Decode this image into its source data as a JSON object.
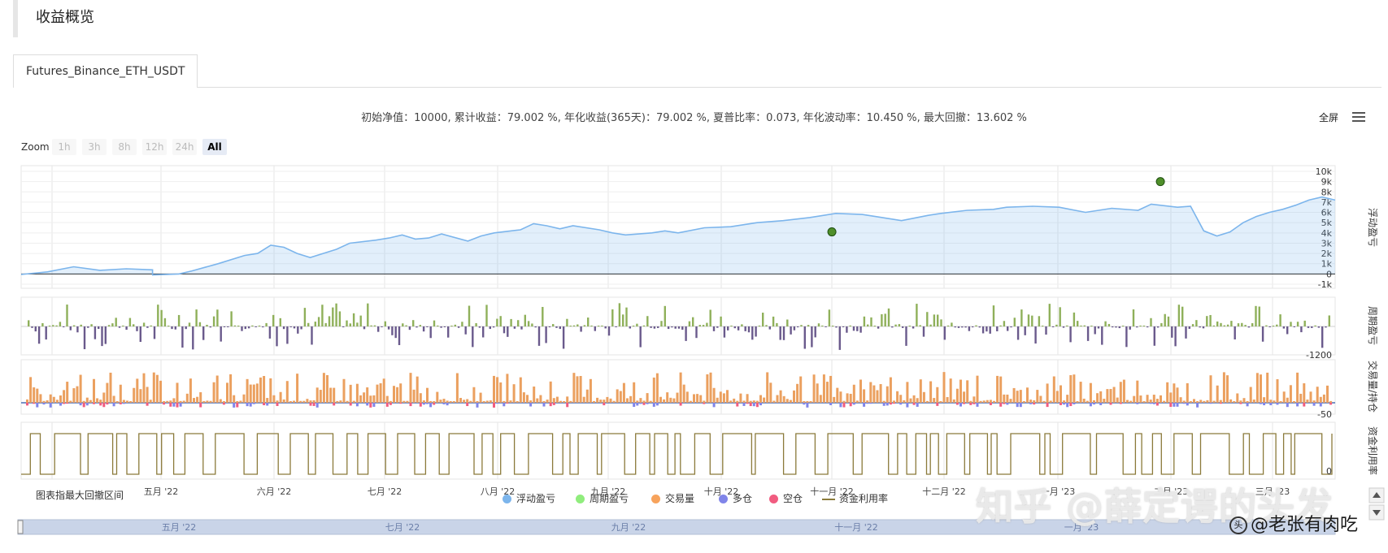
{
  "section": {
    "title": "收益概览"
  },
  "tabs": [
    {
      "label": "Futures_Binance_ETH_USDT",
      "active": true
    }
  ],
  "summary": "初始净值：10000, 累计收益：79.002 %, 年化收益(365天)：79.002 %, 夏普比率：0.073, 年化波动率：10.450 %, 最大回撤：13.602 %",
  "toolbar": {
    "fullscreen": "全屏",
    "menu_icon": "menu-icon"
  },
  "zoom": {
    "label": "Zoom",
    "buttons": [
      "1h",
      "3h",
      "8h",
      "12h",
      "24h",
      "All"
    ],
    "active": "All"
  },
  "legend": {
    "drawdown_label": "图表指最大回撤区间",
    "items": [
      {
        "label": "浮动盈亏",
        "color": "#7cb5ec",
        "shape": "dot"
      },
      {
        "label": "周期盈亏",
        "color": "#90ed7d",
        "shape": "dot"
      },
      {
        "label": "交易量",
        "color": "#f7a35c",
        "shape": "dot"
      },
      {
        "label": "多仓",
        "color": "#8085e9",
        "shape": "dot"
      },
      {
        "label": "空仓",
        "color": "#f15c80",
        "shape": "dot"
      },
      {
        "label": "资金利用率",
        "color": "#8b7a3a",
        "shape": "line"
      }
    ]
  },
  "watermark": {
    "main": "知乎 @薛定谔的头发",
    "sub": "@老张有肉吃",
    "sub_icon": "头"
  },
  "chart_data": {
    "type": "line",
    "x_axis_labels": [
      "五月 '22",
      "六月 '22",
      "七月 '22",
      "八月 '22",
      "九月 '22",
      "十月 '22",
      "十一月 '22",
      "十二月 '22",
      "一月 '23",
      "二月 '23",
      "三月 '23"
    ],
    "navigator_labels": [
      "五月 '22",
      "七月 '22",
      "九月 '22",
      "十一月 '22",
      "一月 '23"
    ],
    "panes": [
      {
        "name": "浮动盈亏",
        "type": "area",
        "color": "#7cb5ec",
        "ytick_labels": [
          "10k",
          "9k",
          "8k",
          "7k",
          "6k",
          "5k",
          "4k",
          "3k",
          "2k",
          "1k",
          "0",
          "-1k"
        ],
        "ylim": [
          -1000,
          10000
        ],
        "x_range": [
          0,
          1
        ],
        "points": [
          [
            0,
            -50
          ],
          [
            0.02,
            200
          ],
          [
            0.04,
            700
          ],
          [
            0.06,
            350
          ],
          [
            0.08,
            500
          ],
          [
            0.1,
            400
          ],
          [
            0.1,
            300
          ],
          [
            0.1,
            -100
          ],
          [
            0.12,
            0
          ],
          [
            0.13,
            300
          ],
          [
            0.15,
            1000
          ],
          [
            0.17,
            1800
          ],
          [
            0.18,
            2000
          ],
          [
            0.19,
            2800
          ],
          [
            0.2,
            2600
          ],
          [
            0.21,
            2000
          ],
          [
            0.22,
            1600
          ],
          [
            0.24,
            2400
          ],
          [
            0.25,
            3000
          ],
          [
            0.27,
            3300
          ],
          [
            0.28,
            3500
          ],
          [
            0.29,
            3800
          ],
          [
            0.3,
            3400
          ],
          [
            0.31,
            3500
          ],
          [
            0.32,
            3900
          ],
          [
            0.34,
            3200
          ],
          [
            0.35,
            3700
          ],
          [
            0.36,
            4000
          ],
          [
            0.38,
            4300
          ],
          [
            0.39,
            4900
          ],
          [
            0.4,
            4700
          ],
          [
            0.41,
            4400
          ],
          [
            0.42,
            4700
          ],
          [
            0.44,
            4300
          ],
          [
            0.45,
            4000
          ],
          [
            0.46,
            3800
          ],
          [
            0.48,
            4000
          ],
          [
            0.49,
            4200
          ],
          [
            0.5,
            4000
          ],
          [
            0.52,
            4500
          ],
          [
            0.54,
            4600
          ],
          [
            0.56,
            5000
          ],
          [
            0.58,
            5200
          ],
          [
            0.6,
            5500
          ],
          [
            0.62,
            5900
          ],
          [
            0.64,
            5800
          ],
          [
            0.65,
            5600
          ],
          [
            0.67,
            5200
          ],
          [
            0.69,
            5700
          ],
          [
            0.7,
            5900
          ],
          [
            0.72,
            6200
          ],
          [
            0.74,
            6300
          ],
          [
            0.75,
            6500
          ],
          [
            0.77,
            6600
          ],
          [
            0.79,
            6500
          ],
          [
            0.81,
            6000
          ],
          [
            0.83,
            6400
          ],
          [
            0.85,
            6200
          ],
          [
            0.86,
            6800
          ],
          [
            0.88,
            6500
          ],
          [
            0.89,
            6600
          ],
          [
            0.9,
            4200
          ],
          [
            0.91,
            3700
          ],
          [
            0.92,
            4100
          ],
          [
            0.93,
            5000
          ],
          [
            0.94,
            5600
          ],
          [
            0.95,
            6000
          ],
          [
            0.96,
            6300
          ],
          [
            0.97,
            6700
          ],
          [
            0.98,
            7200
          ],
          [
            0.99,
            7500
          ],
          [
            1,
            7200
          ]
        ]
      },
      {
        "name": "周期盈亏",
        "type": "bar",
        "color": "#90ed7d",
        "ytick_labels": [
          "-1200"
        ]
      },
      {
        "name": "交易量/持仓",
        "type": "bar",
        "color": "#f7a35c",
        "ytick_labels": [
          "-50"
        ]
      },
      {
        "name": "资金利用率",
        "type": "step",
        "color": "#8b7a3a",
        "ytick_labels": [
          "0"
        ]
      }
    ],
    "markers": [
      {
        "name": "最大回撤低点",
        "x": 0.617,
        "y": 4100,
        "color": "#2a6f1e"
      },
      {
        "name": "最大回撤高点",
        "x": 0.867,
        "y": 9000,
        "color": "#2a6f1e"
      }
    ],
    "right_axis_titles": [
      "浮动盈亏",
      "周期盈亏",
      "交易量/持仓",
      "资金利用率"
    ]
  }
}
